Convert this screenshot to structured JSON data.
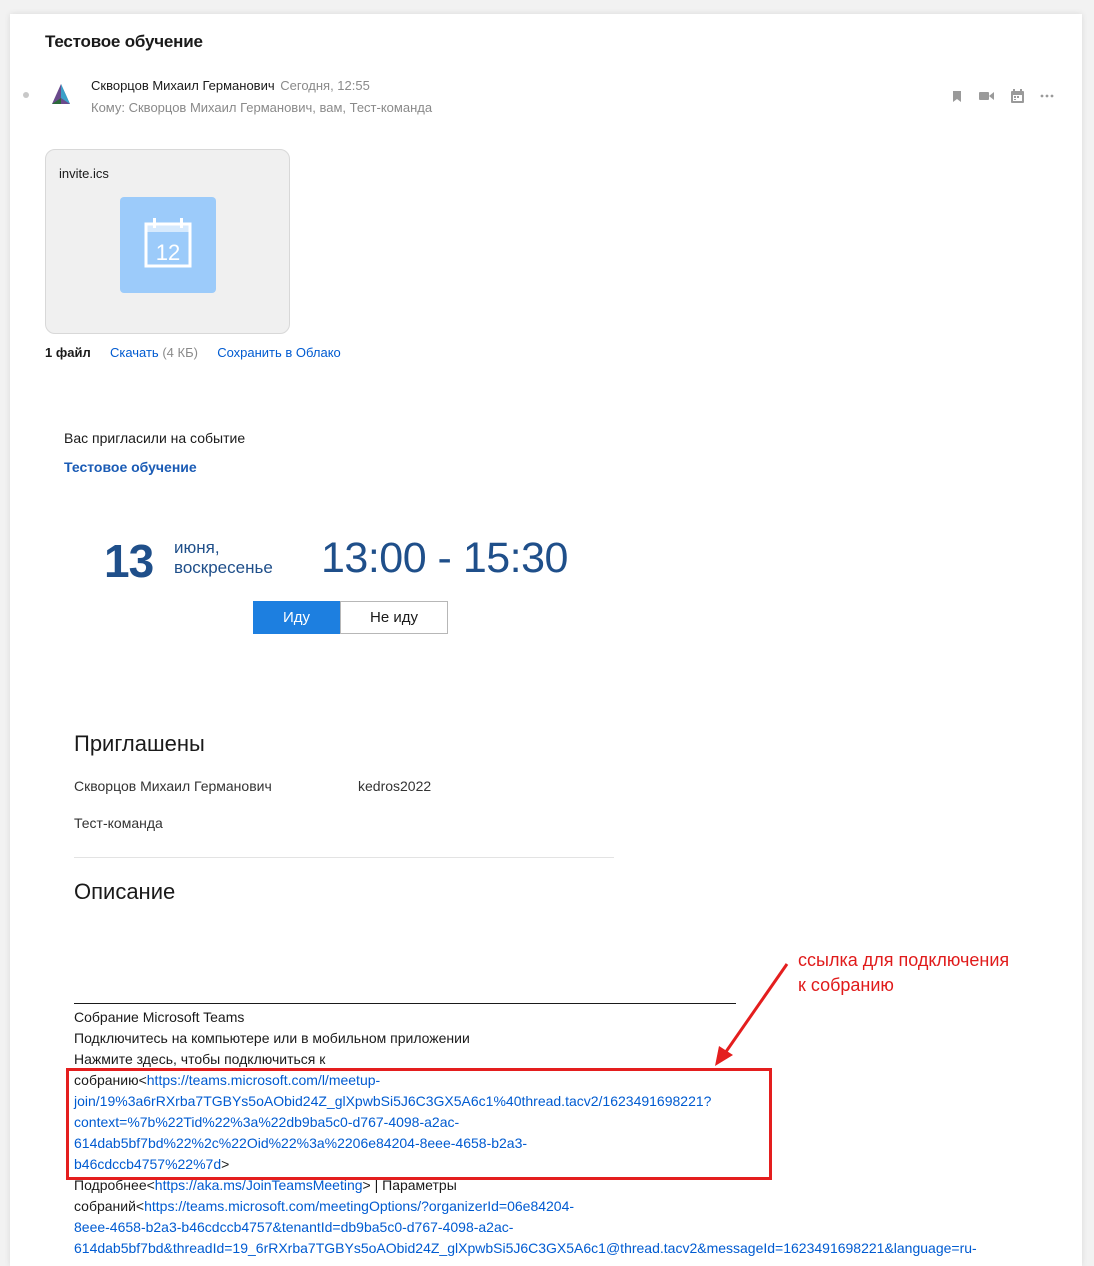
{
  "email": {
    "subject": "Тестовое обучение",
    "sender_name": "Скворцов Михаил Германович",
    "sent_time": "Сегодня, 12:55",
    "recipients": "Кому: Скворцов Михаил Германович, вам, Тест-команда",
    "toolbar_icons": [
      "bookmark-icon",
      "video-icon",
      "calendar-icon",
      "more-icon"
    ]
  },
  "attachment": {
    "file_name": "invite.ics",
    "icon_day": "12",
    "files_count": "1 файл",
    "download_label": "Скачать",
    "size_label": "(4 КБ)",
    "save_cloud_label": "Сохранить в Облако"
  },
  "invite": {
    "intro": "Вас пригласили на событие",
    "title": "Тестовое обучение",
    "day": "13",
    "month": "июня,",
    "weekday": "воскресенье",
    "time": "13:00 - 15:30",
    "go_label": "Иду",
    "nogo_label": "Не иду"
  },
  "attendees": {
    "heading": "Приглашены",
    "list": [
      {
        "name": "Скворцов Михаил Германович",
        "extra": "kedros2022"
      },
      {
        "name": "Тест-команда",
        "extra": ""
      }
    ]
  },
  "description": {
    "heading": "Описание",
    "line1": "Собрание Microsoft Teams",
    "line2": "Подключитесь на компьютере или в мобильном приложении",
    "line3": "Нажмите здесь, чтобы подключиться к",
    "join_prefix": "собранию<",
    "join_url_1": "https://teams.microsoft.com/l/meetup-",
    "join_url_2": "join/19%3a6rRXrba7TGBYs5oAObid24Z_glXpwbSi5J6C3GX5A6c1%40thread.tacv2/1623491698221?",
    "join_url_3": "context=%7b%22Tid%22%3a%22db9ba5c0-d767-4098-a2ac-",
    "join_url_4": "614dab5bf7bd%22%2c%22Oid%22%3a%2206e84204-8eee-4658-b2a3-",
    "join_url_5": "b46cdccb4757%22%7d",
    "join_suffix": ">",
    "more_prefix": "Подробнее<",
    "more_url": "https://aka.ms/JoinTeamsMeeting",
    "more_suffix": "> | Параметры",
    "options_prefix": "собраний<",
    "options_url_1": "https://teams.microsoft.com/meetingOptions/?organizerId=06e84204-",
    "options_url_2": "8eee-4658-b2a3-b46cdccb4757&tenantId=db9ba5c0-d767-4098-a2ac-",
    "options_url_3": "614dab5bf7bd&threadId=19_6rRXrba7TGBYs5oAObid24Z_glXpwbSi5J6C3GX5A6c1@thread.tacv2&messageId=1623491698221&language=ru-"
  },
  "annotation": {
    "line1": "ссылка для подключения",
    "line2": "к собранию",
    "color": "#e41e1e"
  }
}
